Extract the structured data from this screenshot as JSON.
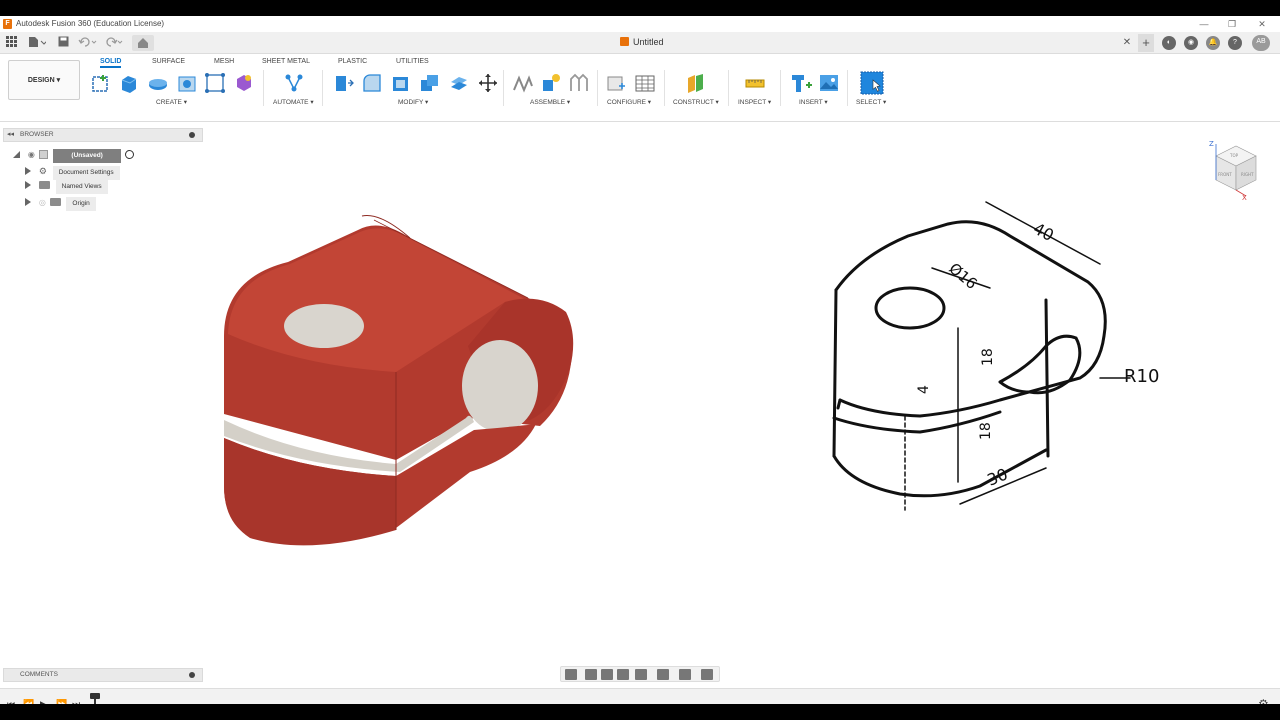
{
  "window": {
    "title": "Autodesk Fusion 360 (Education License)"
  },
  "document": {
    "title": "Untitled"
  },
  "user": {
    "initials": "AB"
  },
  "workspace": {
    "label": "DESIGN ▾"
  },
  "tabs": [
    "SOLID",
    "SURFACE",
    "MESH",
    "SHEET METAL",
    "PLASTIC",
    "UTILITIES"
  ],
  "groups": [
    "CREATE ▾",
    "AUTOMATE ▾",
    "MODIFY ▾",
    "ASSEMBLE ▾",
    "CONFIGURE ▾",
    "CONSTRUCT ▾",
    "INSPECT ▾",
    "INSERT ▾",
    "SELECT ▾"
  ],
  "browser": {
    "title": "BROWSER",
    "root": "(Unsaved)",
    "items": [
      "Document Settings",
      "Named Views",
      "Origin"
    ]
  },
  "comments": {
    "title": "COMMENTS"
  },
  "viewcube": {
    "top": "TOP",
    "front": "FRONT",
    "right": "RIGHT",
    "z": "Z",
    "x": "X"
  },
  "drawing_dims": {
    "d1": "40",
    "d2": "Ø16",
    "d3": "R10",
    "d4": "18",
    "d5": "4",
    "d6": "18",
    "d7": "30"
  },
  "colors": {
    "part_red": "#b83a30",
    "accent": "#0a74c9",
    "logo": "#e8710a"
  },
  "icons": [
    "grid-icon",
    "file-icon",
    "save-icon",
    "undo-icon",
    "redo-icon",
    "home-icon",
    "close-tab-icon",
    "add-tab-icon",
    "extensions-icon",
    "job-status-icon",
    "notifications-icon",
    "help-icon",
    "settings-icon"
  ]
}
